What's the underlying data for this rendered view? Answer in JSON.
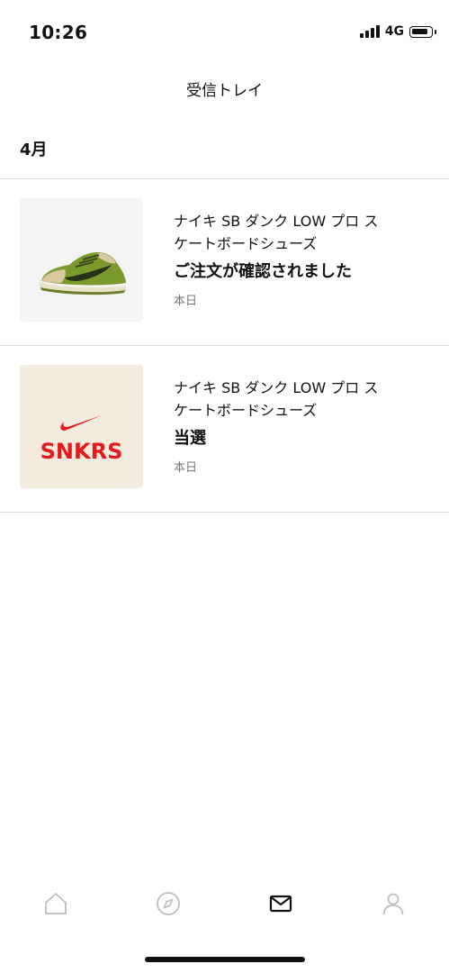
{
  "status_bar": {
    "time": "10:26",
    "network": "4G"
  },
  "header": {
    "title": "受信トレイ"
  },
  "section": {
    "heading": "4月"
  },
  "messages": [
    {
      "product_line1": "ナイキ SB ダンク LOW プロ ス",
      "product_line2": "ケートボードシューズ",
      "status": "ご注文が確認されました",
      "date": "本日",
      "thumbnail_icon": "green-sneaker-image"
    },
    {
      "product_line1": "ナイキ SB ダンク LOW プロ ス",
      "product_line2": "ケートボードシューズ",
      "status": "当選",
      "date": "本日",
      "thumbnail_icon": "snkrs-logo",
      "thumbnail_logo_text": "SNKRS"
    }
  ],
  "tab_bar": {
    "tabs": [
      {
        "icon": "home-icon",
        "active": false
      },
      {
        "icon": "compass-icon",
        "active": false
      },
      {
        "icon": "mail-icon",
        "active": true
      },
      {
        "icon": "profile-icon",
        "active": false
      }
    ]
  },
  "colors": {
    "text": "#111111",
    "muted": "#757575",
    "divider": "#dcdcdc",
    "inactive_icon": "#bdbdbd",
    "snkrs_red": "#e4191c",
    "snkrs_bg": "#f3ebde",
    "shoe_green": "#6f8f2c"
  }
}
